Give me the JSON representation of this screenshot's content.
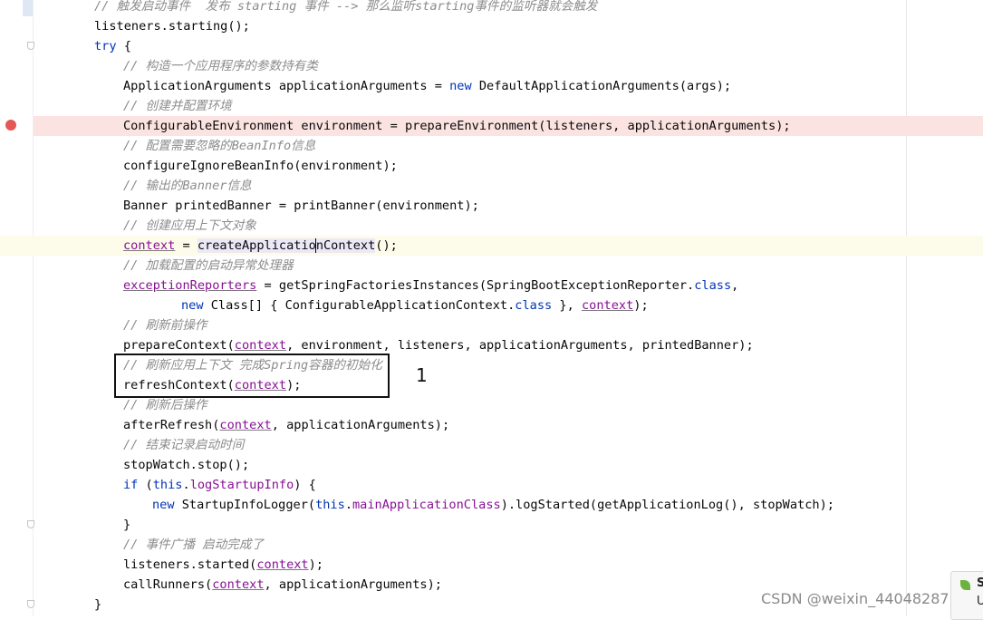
{
  "editor": {
    "lines": [
      {
        "c1": "// 触发启动事件  发布 starting 事件 --> 那么监听starting事件的监听器就会触发"
      },
      {
        "c1": "listeners.starting();"
      },
      {
        "kw": "try",
        "c1": " {"
      },
      {
        "c1": "// 构造一个应用程序的参数持有类"
      },
      {
        "c1": "ApplicationArguments applicationArguments = ",
        "kw": "new",
        "c2": " DefaultApplicationArguments(args);"
      },
      {
        "c1": "// 创建并配置环境"
      },
      {
        "c1": "ConfigurableEnvironment environment = prepareEnvironment(listeners, applicationArguments);"
      },
      {
        "c1": "// 配置需要忽略的BeanInfo信息"
      },
      {
        "c1": "configureIgnoreBeanInfo(environment);"
      },
      {
        "c1": "// 输出的Banner信息"
      },
      {
        "c1": "Banner printedBanner = printBanner(environment);"
      },
      {
        "c1": "// 创建应用上下文对象"
      },
      {
        "ctx": "context",
        "c1": " = ",
        "hl1": "createApplicatio",
        "hl2": "nContext",
        "c2": "();"
      },
      {
        "c1": "// 加载配置的启动异常处理器"
      },
      {
        "fld1": "exceptionReporters",
        "c1": " = getSpringFactoriesInstances(SpringBootExceptionReporter.",
        "kw": "class",
        "c2": ","
      },
      {
        "kw": "new",
        "c1": " Class[] { ConfigurableApplicationContext.",
        "kw2": "class",
        "c2": " }, ",
        "ctx": "context",
        "c3": ");"
      },
      {
        "c1": "// 刷新前操作"
      },
      {
        "c1": "prepareContext(",
        "ctx": "context",
        "c2": ", environment, listeners, applicationArguments, printedBanner);"
      },
      {
        "c1": "// 刷新应用上下文 完成Spring容器的初始化"
      },
      {
        "c1": "refreshContext(",
        "ctx": "context",
        "c2": ");"
      },
      {
        "c1": "// 刷新后操作"
      },
      {
        "c1": "afterRefresh(",
        "ctx": "context",
        "c2": ", applicationArguments);"
      },
      {
        "c1": "// 结束记录启动时间"
      },
      {
        "c1": "stopWatch.stop();"
      },
      {
        "kw": "if",
        "c1": " (",
        "kw2": "this",
        "c2": ".",
        "fld1": "logStartupInfo",
        "c3": ") {"
      },
      {
        "kw": "new",
        "c1": " StartupInfoLogger(",
        "kw2": "this",
        "c2": ".",
        "fld1": "mainApplicationClass",
        "c3": ").logStarted(getApplicationLog(), stopWatch);"
      },
      {
        "c1": "}"
      },
      {
        "c1": "// 事件广播 启动完成了"
      },
      {
        "c1": "listeners.started(",
        "ctx": "context",
        "c2": ");"
      },
      {
        "c1": "callRunners(",
        "ctx": "context",
        "c2": ", applicationArguments);"
      },
      {
        "c1": "}"
      }
    ]
  },
  "annotation": {
    "number": "1"
  },
  "watermark": "CSDN @weixin_44048287",
  "popup": {
    "s_text": "S",
    "u_text": "U"
  },
  "colors": {
    "keyword": "#0033b3",
    "comment": "#8c8c8c",
    "field": "#871094",
    "breakpoint": "#e55757",
    "breakpoint_line": "#fae3e0"
  }
}
